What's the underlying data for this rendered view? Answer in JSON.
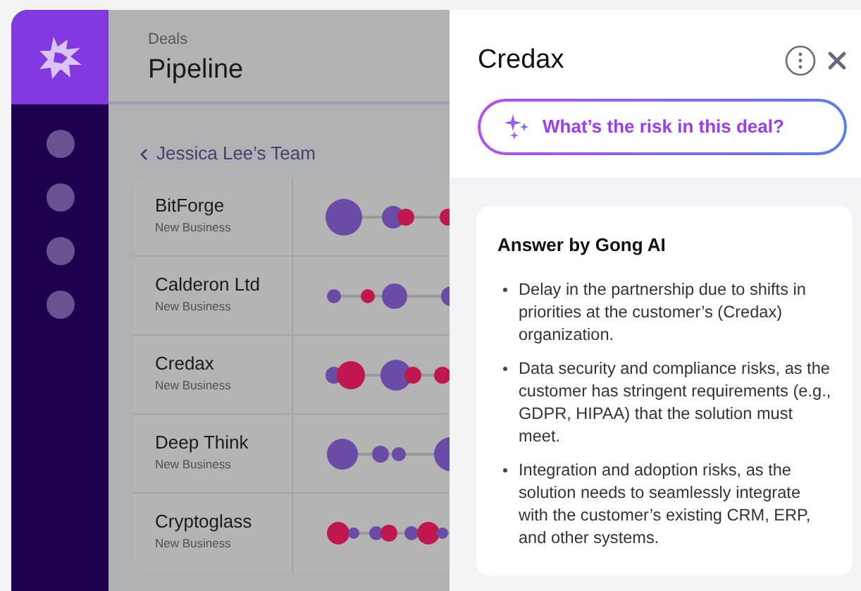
{
  "header": {
    "breadcrumb": "Deals",
    "title": "Pipeline"
  },
  "team": {
    "label": "Jessica Lee’s Team"
  },
  "deals": [
    {
      "name": "BitForge",
      "type": "New Business"
    },
    {
      "name": "Calderon Ltd",
      "type": "New Business"
    },
    {
      "name": "Credax",
      "type": "New Business"
    },
    {
      "name": "Deep Think",
      "type": "New Business"
    },
    {
      "name": "Cryptoglass",
      "type": "New Business"
    }
  ],
  "panel": {
    "title": "Credax",
    "prompt": "What’s the risk in this deal?",
    "answer": {
      "title": "Answer by Gong AI",
      "items": [
        "Delay in the partnership due to shifts in priorities at the customer’s (Credax) organization.",
        "Data security and compliance risks, as the customer has stringent requirements (e.g., GDPR, HIPAA) that the solution must meet.",
        "Integration and adoption risks, as the solution needs to seamlessly integrate with the customer’s existing CRM, ERP, and other systems."
      ]
    }
  }
}
